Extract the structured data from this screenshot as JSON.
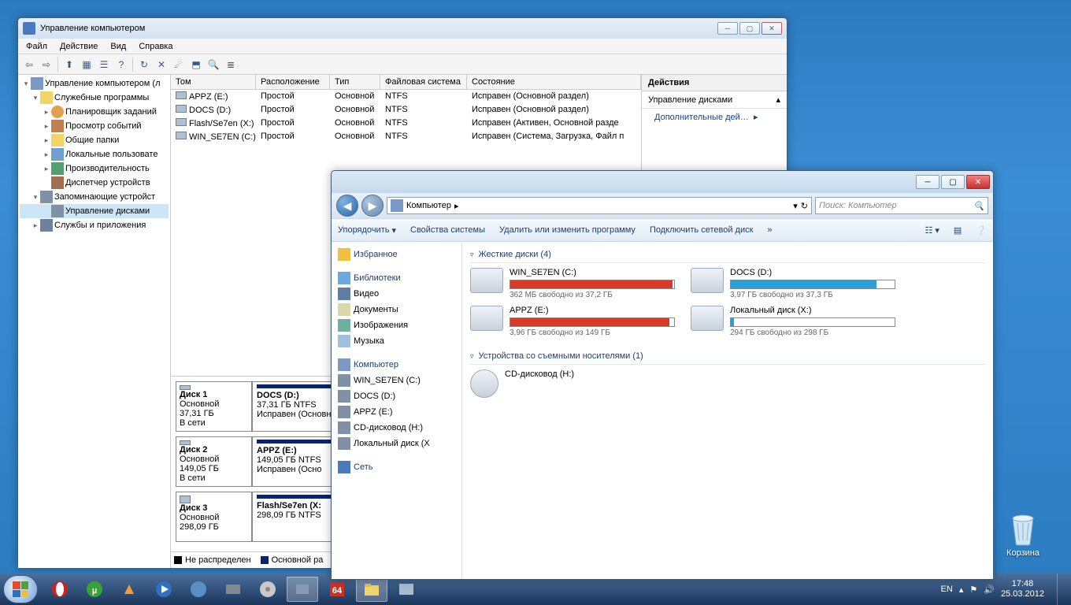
{
  "desktop": {
    "recycle_label": "Корзина"
  },
  "compmgmt": {
    "title": "Управление компьютером",
    "menu": [
      "Файл",
      "Действие",
      "Вид",
      "Справка"
    ],
    "tree": {
      "root": "Управление компьютером (л",
      "util": "Служебные программы",
      "sched": "Планировщик заданий",
      "event": "Просмотр событий",
      "shared": "Общие папки",
      "users": "Локальные пользовате",
      "perf": "Производительность",
      "devmgr": "Диспетчер устройств",
      "storage": "Запоминающие устройст",
      "diskmgmt": "Управление дисками",
      "services": "Службы и приложения"
    },
    "columns": {
      "vol": "Том",
      "layout": "Расположение",
      "type": "Тип",
      "fs": "Файловая система",
      "status": "Состояние"
    },
    "volumes": [
      {
        "vol": "APPZ (E:)",
        "layout": "Простой",
        "type": "Основной",
        "fs": "NTFS",
        "status": "Исправен (Основной раздел)"
      },
      {
        "vol": "DOCS (D:)",
        "layout": "Простой",
        "type": "Основной",
        "fs": "NTFS",
        "status": "Исправен (Основной раздел)"
      },
      {
        "vol": "Flash/Se7en (X:)",
        "layout": "Простой",
        "type": "Основной",
        "fs": "NTFS",
        "status": "Исправен (Активен, Основной разде"
      },
      {
        "vol": "WIN_SE7EN (C:)",
        "layout": "Простой",
        "type": "Основной",
        "fs": "NTFS",
        "status": "Исправен (Система, Загрузка, Файл п"
      }
    ],
    "actions": {
      "head": "Действия",
      "sub": "Управление дисками",
      "more": "Дополнительные дей…"
    },
    "disks": [
      {
        "name": "Диск 1",
        "type": "Основной",
        "size": "37,31 ГБ",
        "online": "В сети",
        "parts": [
          {
            "name": "DOCS  (D:)",
            "detail": "37,31 ГБ NTFS",
            "status": "Исправен (Основн"
          }
        ]
      },
      {
        "name": "Диск 2",
        "type": "Основной",
        "size": "149,05 ГБ",
        "online": "В сети",
        "parts": [
          {
            "name": "APPZ  (E:)",
            "detail": "149,05 ГБ NTFS",
            "status": "Исправен (Осно"
          }
        ]
      },
      {
        "name": "Диск 3",
        "type": "Основной",
        "size": "298,09 ГБ",
        "online": "",
        "parts": [
          {
            "name": "Flash/Se7en  (X:",
            "detail": "298,09 ГБ NTFS",
            "status": ""
          }
        ]
      }
    ],
    "legend": {
      "unalloc": "Не распределен",
      "primary": "Основной ра"
    }
  },
  "explorer": {
    "breadcrumb": "Компьютер",
    "search_placeholder": "Поиск: Компьютер",
    "cmd": {
      "org": "Упорядочить",
      "props": "Свойства системы",
      "uninstall": "Удалить или изменить программу",
      "mapnet": "Подключить сетевой диск"
    },
    "tree": {
      "fav": "Избранное",
      "lib": "Библиотеки",
      "vid": "Видео",
      "doc": "Документы",
      "img": "Изображения",
      "mus": "Музыка",
      "comp": "Компьютер",
      "c": "WIN_SE7EN (C:)",
      "d": "DOCS (D:)",
      "e": "APPZ (E:)",
      "h": "CD-дисковод (H:)",
      "x": "Локальный диск (X",
      "net": "Сеть"
    },
    "groups": {
      "hdd": "Жесткие диски (4)",
      "removable": "Устройства со съемными носителями (1)"
    },
    "drives": [
      {
        "name": "WIN_SE7EN (C:)",
        "free": "362 МБ свободно из 37,2 ГБ",
        "fill": 99,
        "color": "#d83a2a"
      },
      {
        "name": "DOCS (D:)",
        "free": "3,97 ГБ свободно из 37,3 ГБ",
        "fill": 89,
        "color": "#2a9fd8"
      },
      {
        "name": "APPZ (E:)",
        "free": "3,96 ГБ свободно из 149 ГБ",
        "fill": 97,
        "color": "#d83a2a"
      },
      {
        "name": "Локальный диск (X:)",
        "free": "294 ГБ свободно из 298 ГБ",
        "fill": 2,
        "color": "#2a9fd8"
      }
    ],
    "cd": {
      "name": "CD-дисковод (H:)"
    }
  },
  "taskbar": {
    "lang": "EN",
    "time": "17:48",
    "date": "25.03.2012"
  }
}
